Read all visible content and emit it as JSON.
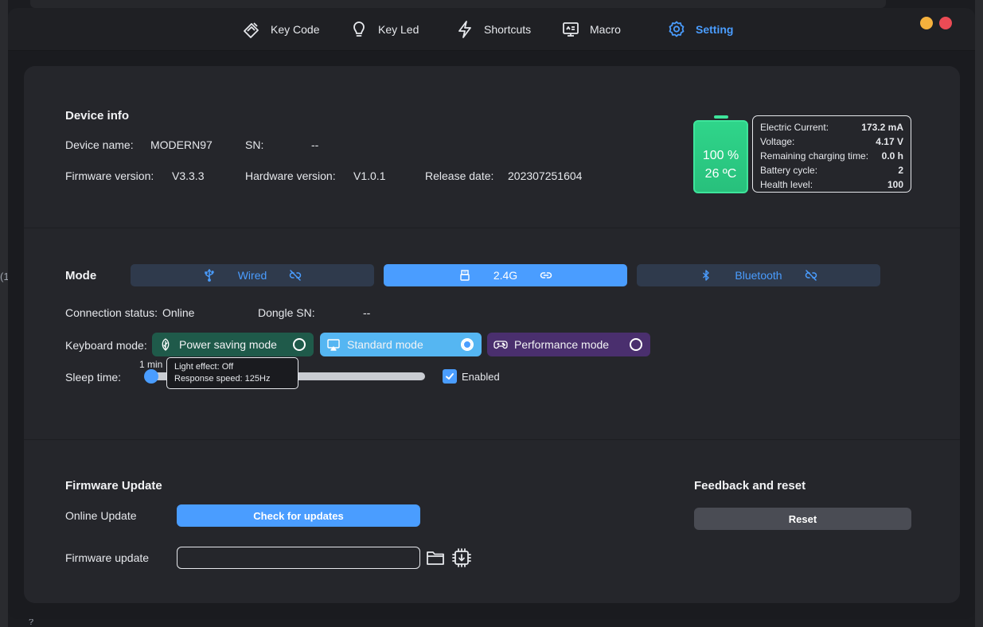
{
  "nav": {
    "items": [
      {
        "label": "Key Code",
        "icon": "keycap-icon"
      },
      {
        "label": "Key Led",
        "icon": "lightbulb-icon"
      },
      {
        "label": "Shortcuts",
        "icon": "lightning-icon"
      },
      {
        "label": "Macro",
        "icon": "monitor-icon"
      },
      {
        "label": "Setting",
        "icon": "gear-icon"
      }
    ],
    "active": "Setting",
    "accent": "#4a9dff"
  },
  "window_controls": {
    "minimize_color": "#f5b13d",
    "close_color": "#ec4b55"
  },
  "background": {
    "fragment_left": "(1",
    "fragment_bottom": "?"
  },
  "device_info": {
    "title": "Device info",
    "device_name_label": "Device name:",
    "device_name": "MODERN97",
    "sn_label": "SN:",
    "sn": "--",
    "firmware_label": "Firmware version:",
    "firmware": "V3.3.3",
    "hardware_label": "Hardware version:",
    "hardware": "V1.0.1",
    "release_label": "Release date:",
    "release": "202307251604"
  },
  "battery": {
    "percent_text": "100 %",
    "temp_text": "26 ºC",
    "level": 1.0,
    "color": "#2fd58a",
    "stats": [
      {
        "label": "Electric Current:",
        "value": "173.2 mA"
      },
      {
        "label": "Voltage:",
        "value": "4.17 V"
      },
      {
        "label": "Remaining charging time:",
        "value": "0.0 h"
      },
      {
        "label": "Battery cycle:",
        "value": "2"
      },
      {
        "label": "Health level:",
        "value": "100"
      }
    ]
  },
  "mode": {
    "title": "Mode",
    "options": [
      {
        "label": "Wired",
        "icon": "usb-icon",
        "link_icon": "unlink-icon",
        "active": false
      },
      {
        "label": "2.4G",
        "icon": "dongle-icon",
        "link_icon": "link-icon",
        "active": true
      },
      {
        "label": "Bluetooth",
        "icon": "bluetooth-icon",
        "link_icon": "unlink-icon",
        "active": false
      }
    ],
    "connection_label": "Connection status:",
    "connection_value": "Online",
    "dongle_label": "Dongle SN:",
    "dongle_value": "--",
    "keyboard_mode_label": "Keyboard mode:",
    "keyboard_modes": [
      {
        "label": "Power saving mode",
        "icon": "leaf-icon",
        "selected": false,
        "color": "#1f5a4a"
      },
      {
        "label": "Standard mode",
        "icon": "screen-icon",
        "selected": true,
        "color": "#55b6f2"
      },
      {
        "label": "Performance mode",
        "icon": "gamepad-icon",
        "selected": false,
        "color": "#4a2f6e"
      }
    ],
    "sleep_label": "Sleep time:",
    "sleep_value_label": "1 min",
    "sleep_level": 0.0,
    "tooltip_line1": "Light effect: Off",
    "tooltip_line2": "Response speed: 125Hz",
    "enabled_label": "Enabled",
    "enabled": true
  },
  "firmware_update": {
    "title": "Firmware Update",
    "online_label": "Online Update",
    "check_button": "Check for updates",
    "file_label": "Firmware update",
    "file_value": "",
    "folder_icon": "folder-icon",
    "flash_icon": "chip-download-icon"
  },
  "feedback": {
    "title": "Feedback and reset",
    "reset_button": "Reset"
  }
}
